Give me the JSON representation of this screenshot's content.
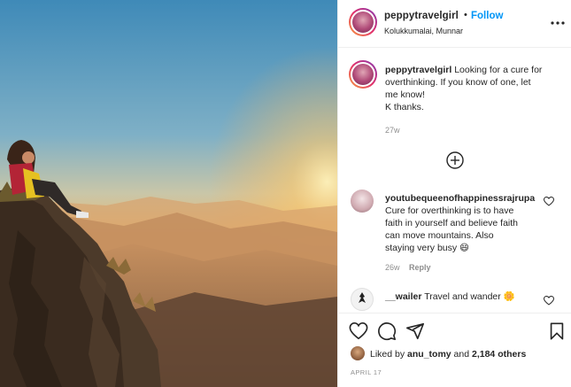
{
  "header": {
    "username": "peppytravelgirl",
    "separator": "•",
    "follow_label": "Follow",
    "location": "Kolukkumalai, Munnar",
    "more_icon": "ellipsis-icon"
  },
  "caption": {
    "username": "peppytravelgirl",
    "lines": [
      "Looking for a cure for",
      "overthinking. If you know of one, let",
      "me know!",
      "K thanks."
    ],
    "time": "27w"
  },
  "load_more": {
    "icon": "plus-circle-icon"
  },
  "comments": [
    {
      "username": "youtubequeenofhappinessrajrupa",
      "lines": [
        "Cure for overthinking is to have",
        "faith in yourself and believe faith",
        "can move mountains. Also",
        "staying very busy 😄"
      ],
      "time": "26w",
      "reply_label": "Reply"
    },
    {
      "username": "__wailer",
      "text": "Travel and wander 🌼"
    }
  ],
  "actions": {
    "like_icon": "heart-icon",
    "comment_icon": "comment-icon",
    "share_icon": "paper-plane-icon",
    "save_icon": "bookmark-icon"
  },
  "likes": {
    "prefix": "Liked by",
    "user": "anu_tomy",
    "joiner": "and",
    "others": "2,184 others"
  },
  "date": "APRIL 17"
}
